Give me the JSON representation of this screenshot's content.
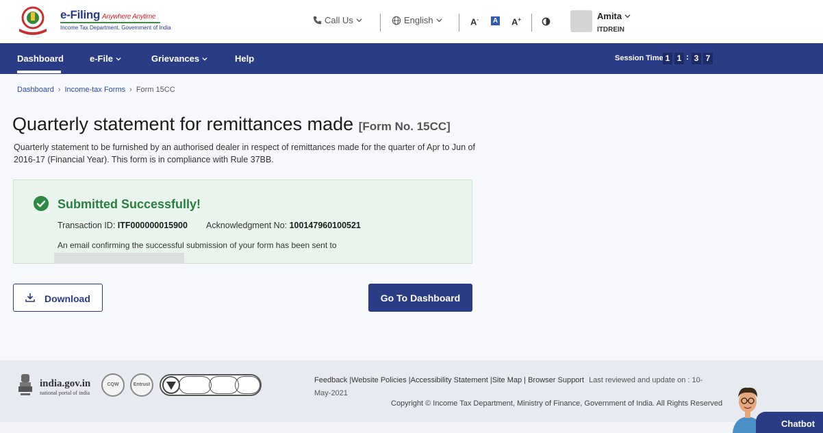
{
  "header": {
    "brand_title": "e-Filing",
    "brand_tagline": "Anywhere Anytime",
    "brand_subtitle": "Income Tax Department, Government of India",
    "call_us": "Call Us",
    "language": "English",
    "font_decrease": "A",
    "font_default": "A",
    "font_increase": "A",
    "user_name": "Amita",
    "user_id": "ITDREIN"
  },
  "nav": {
    "items": [
      {
        "label": "Dashboard"
      },
      {
        "label": "e-File"
      },
      {
        "label": "Grievances"
      },
      {
        "label": "Help"
      }
    ],
    "session_label": "Session Time",
    "session_digits": [
      "1",
      "1",
      "3",
      "7"
    ]
  },
  "breadcrumb": {
    "items": [
      "Dashboard",
      "Income-tax Forms"
    ],
    "current": "Form 15CC"
  },
  "page": {
    "title": "Quarterly statement for remittances made",
    "form_no": "[Form No. 15CC]",
    "description": "Quarterly statement to be furnished by an authorised dealer in respect of remittances made for the quarter of Apr to Jun of 2016-17 (Financial Year). This form is in compliance with Rule 37BB."
  },
  "success": {
    "title": "Submitted Successfully!",
    "txn_label": "Transaction ID:",
    "txn_id": "ITF000000015900",
    "ack_label": "Acknowledgment No:",
    "ack_no": "100147960100521",
    "email_note": "An email confirming the successful submission of your form has been sent to"
  },
  "buttons": {
    "download": "Download",
    "go_dashboard": "Go To Dashboard"
  },
  "footer": {
    "india_name": "india.gov.in",
    "india_sub": "national portal of india",
    "links": [
      "Feedback",
      "Website Policies",
      "Accessibility Statement",
      "Site Map",
      "Browser Support"
    ],
    "last_reviewed": "Last reviewed and update on : 10-May-2021",
    "copyright": "Copyright © Income Tax Department, Ministry of Finance, Government of India. All Rights Reserved"
  },
  "chatbot": {
    "label": "Chatbot"
  },
  "colors": {
    "primary": "#2a3c86",
    "success": "#2a7f3f",
    "success_bg": "#e9f4ed"
  }
}
